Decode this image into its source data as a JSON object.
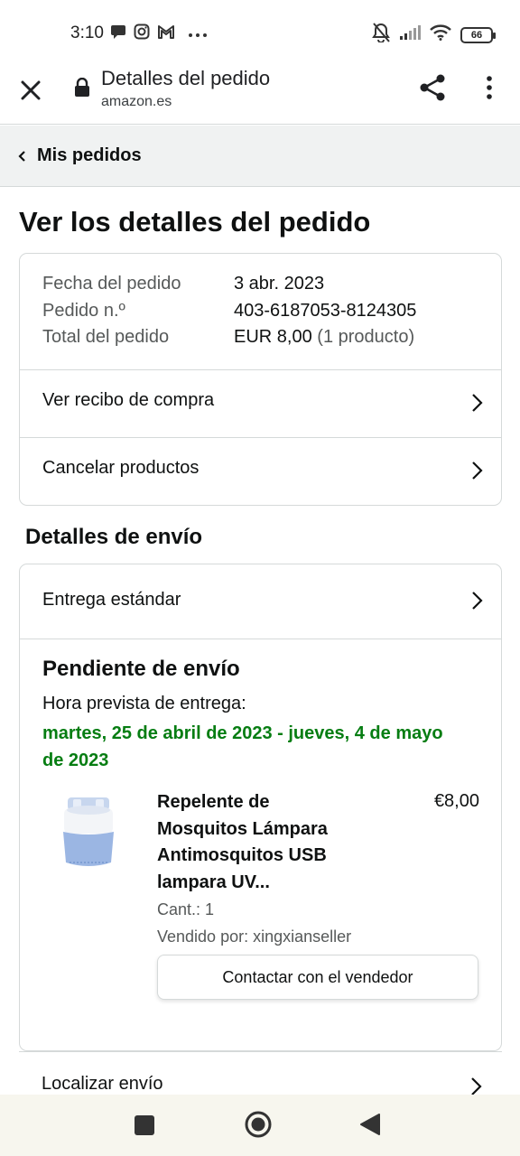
{
  "status_bar": {
    "time": "3:10",
    "battery": "66"
  },
  "browser": {
    "page_title": "Detalles del pedido",
    "host": "amazon.es"
  },
  "breadcrumb": {
    "label": "Mis pedidos"
  },
  "page": {
    "heading": "Ver los detalles del pedido"
  },
  "order_summary": {
    "date_label": "Fecha del pedido",
    "date_value": "3 abr. 2023",
    "number_label": "Pedido n.º",
    "number_value": "403-6187053-8124305",
    "total_label": "Total del pedido",
    "total_value": "EUR 8,00",
    "total_note": "(1 producto)",
    "receipt_link": "Ver recibo de compra",
    "cancel_link": "Cancelar productos"
  },
  "shipping": {
    "section_title": "Detalles de envío",
    "method": "Entrega estándar",
    "status": "Pendiente de envío",
    "eta_label": "Hora prevista de entrega:",
    "eta_range": "martes, 25 de abril de 2023 - jueves, 4 de mayo de 2023",
    "track_link": "Localizar envío"
  },
  "item": {
    "title": "Repelente de Mosquitos Lámpara Antimosquitos USB lampara UV...",
    "price": "€8,00",
    "quantity": "Cant.: 1",
    "seller": "Vendido por: xingxianseller",
    "contact_button": "Contactar con el vendedor"
  },
  "colors": {
    "eta_green": "#067d12",
    "border": "#d5d9d9",
    "breadcrumb_bg": "#f0f2f2"
  }
}
